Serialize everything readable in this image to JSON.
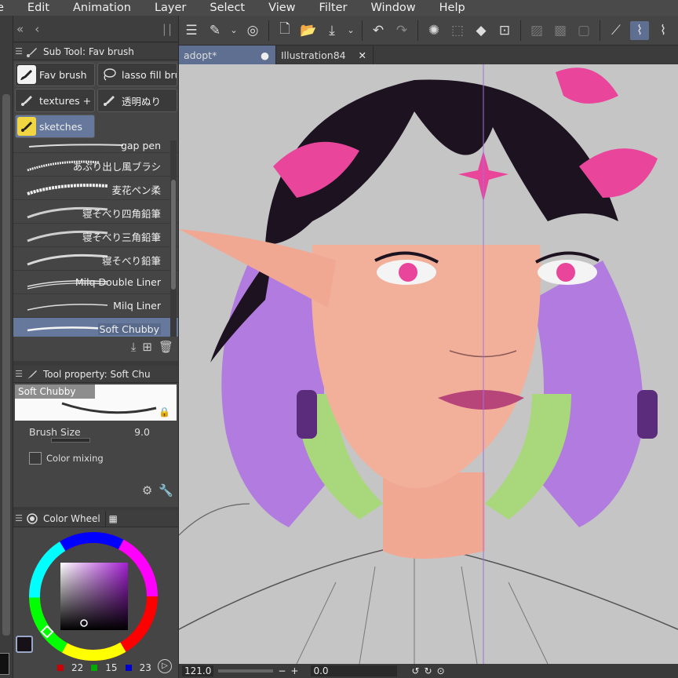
{
  "menu": [
    "e",
    "Edit",
    "Animation",
    "Layer",
    "Select",
    "View",
    "Filter",
    "Window",
    "Help"
  ],
  "subtool": {
    "title": "Sub Tool: Fav brush",
    "groups": [
      {
        "label": "Fav brush",
        "icon": "brush-icon"
      },
      {
        "label": "lasso fill bru",
        "icon": "lasso-icon"
      },
      {
        "label": "textures + h",
        "icon": "texture-brush-icon"
      },
      {
        "label": "透明ぬり",
        "icon": "brush-icon"
      },
      {
        "label": "sketches",
        "icon": "brush-icon"
      }
    ],
    "brushes": [
      "gap pen",
      "あぶり出し風ブラシ",
      "麦花ペン柔",
      "寝そべり四角鉛筆",
      "寝そべり三角鉛筆",
      "寝そべり鉛筆",
      "Milq Double Liner",
      "Milq Liner",
      "Soft Chubby"
    ],
    "selected_brush": "Soft Chubby"
  },
  "toolprop": {
    "title": "Tool property: Soft Chu",
    "preview_label": "Soft Chubby",
    "brush_size_label": "Brush Size",
    "brush_size_value": "9.0",
    "color_mixing_label": "Color mixing"
  },
  "colorwheel": {
    "title": "Color Wheel",
    "r": "22",
    "g": "15",
    "b": "23",
    "accent": "#66789c"
  },
  "tabs": [
    {
      "label": "adopt*",
      "active": true
    },
    {
      "label": "Illustration84",
      "active": false
    }
  ],
  "status": {
    "zoom": "121.0",
    "angle": "0.0"
  }
}
